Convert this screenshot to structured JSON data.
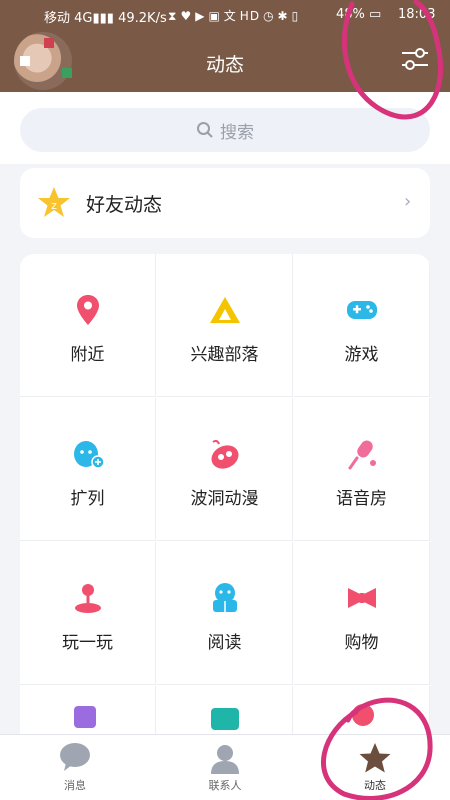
{
  "status_bar": {
    "carrier": "移动",
    "network_speed": "49.2K/s",
    "battery": "48%",
    "time": "18:03"
  },
  "header": {
    "title": "动态"
  },
  "search": {
    "placeholder": "搜索"
  },
  "friend_feed": {
    "label": "好友动态"
  },
  "grid": [
    {
      "label": "附近",
      "icon": "location-pin-icon",
      "color": "#f0506e"
    },
    {
      "label": "兴趣部落",
      "icon": "tribe-tent-icon",
      "color": "#f5c400"
    },
    {
      "label": "游戏",
      "icon": "gamepad-icon",
      "color": "#2bb7e8"
    },
    {
      "label": "扩列",
      "icon": "add-friend-icon",
      "color": "#2bb7e8"
    },
    {
      "label": "波洞动漫",
      "icon": "anime-icon",
      "color": "#f0506e"
    },
    {
      "label": "语音房",
      "icon": "microphone-icon",
      "color": "#f06c9a"
    },
    {
      "label": "玩一玩",
      "icon": "joystick-icon",
      "color": "#f0506e"
    },
    {
      "label": "阅读",
      "icon": "reading-icon",
      "color": "#2bb7e8"
    },
    {
      "label": "购物",
      "icon": "shopping-bow-icon",
      "color": "#f0506e"
    }
  ],
  "bottom_nav": [
    {
      "label": "消息",
      "icon": "message-bubble-icon"
    },
    {
      "label": "联系人",
      "icon": "contacts-icon"
    },
    {
      "label": "动态",
      "icon": "star-icon",
      "active": true
    }
  ],
  "colors": {
    "header_bg": "#7a5a47",
    "accent_annotation": "#d6337a"
  }
}
